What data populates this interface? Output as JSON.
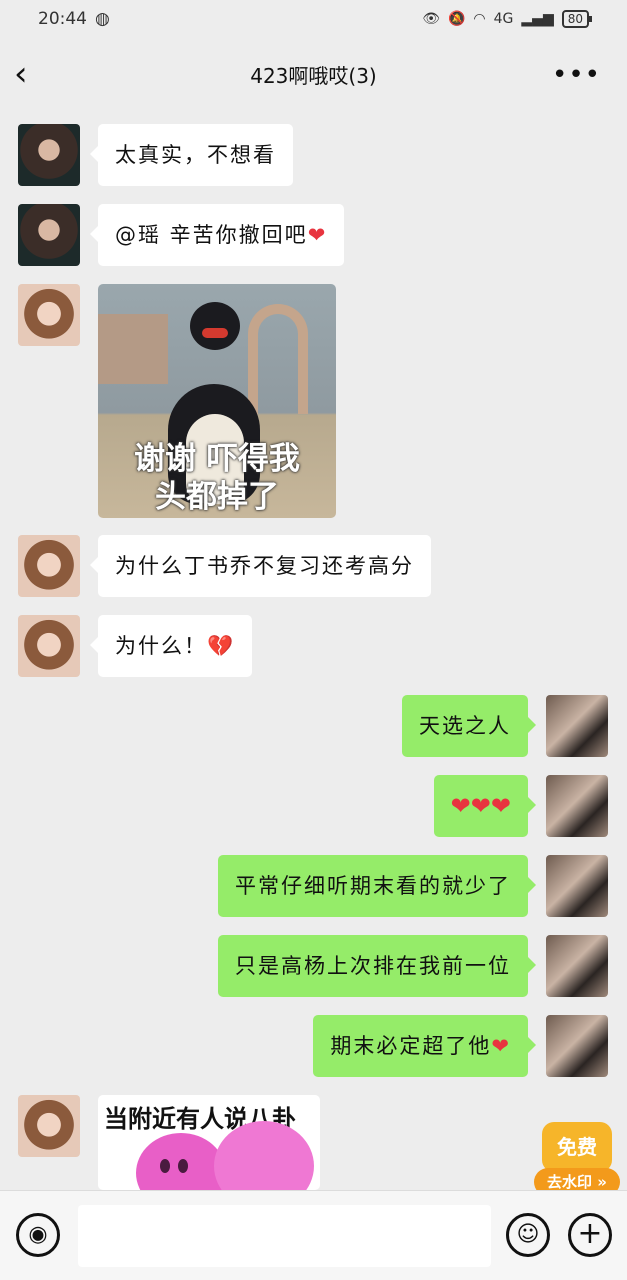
{
  "status_bar": {
    "time": "20:44",
    "network": "4G",
    "battery": "80"
  },
  "nav": {
    "back_icon": "chevron-left-icon",
    "title": "423啊哦哎(3)",
    "more_icon": "more-dots-icon"
  },
  "messages": [
    {
      "side": "in",
      "avatar": "dark",
      "text": "太真实，不想看"
    },
    {
      "side": "in",
      "avatar": "dark",
      "text": "@瑶  辛苦你撤回吧",
      "suffix": "❤"
    },
    {
      "side": "in",
      "avatar": "girl",
      "type": "sticker",
      "caption_line1": "谢谢 吓得我",
      "caption_line2": "头都掉了"
    },
    {
      "side": "in",
      "avatar": "girl",
      "text": "为什么丁书乔不复习还考高分"
    },
    {
      "side": "in",
      "avatar": "girl",
      "text": "为什么！",
      "suffix": "💔"
    },
    {
      "side": "out",
      "avatar": "me",
      "text": "天选之人"
    },
    {
      "side": "out",
      "avatar": "me",
      "text": "❤❤❤"
    },
    {
      "side": "out",
      "avatar": "me",
      "text": "平常仔细听期末看的就少了"
    },
    {
      "side": "out",
      "avatar": "me",
      "text": "只是高杨上次排在我前一位"
    },
    {
      "side": "out",
      "avatar": "me",
      "text": "期末必定超了他",
      "suffix": "❤"
    },
    {
      "side": "in",
      "avatar": "girl",
      "type": "sticker",
      "caption": "当附近有人说八卦"
    }
  ],
  "watermark_badge": {
    "free_label": "免费",
    "remove_label": "去水印 »"
  },
  "input_bar": {
    "voice_icon": "voice-icon",
    "emoji_icon": "emoji-icon",
    "plus_icon": "plus-icon",
    "input_value": ""
  },
  "colors": {
    "background": "#ededed",
    "outgoing_bubble": "#95ec69",
    "incoming_bubble": "#ffffff",
    "heart": "#e8343f"
  }
}
